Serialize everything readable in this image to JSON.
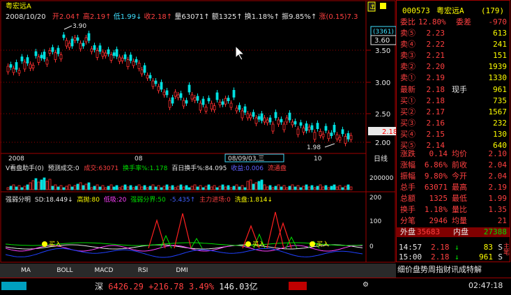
{
  "stock": {
    "code": "000573",
    "name": "粤宏远A",
    "count": "(179)"
  },
  "header": {
    "name": "粤宏远A",
    "date": "2008/10/20",
    "open_label": "开",
    "open": "2.04",
    "high_label": "高",
    "high": "2.19",
    "low_label": "低",
    "low": "1.99",
    "close_label": "收",
    "close": "2.18",
    "volume_label": "量",
    "volume": "63071",
    "amount_label": "额",
    "amount": "1325",
    "turnover_label": "换",
    "turnover": "1.18%",
    "amplitude_label": "振",
    "amplitude": "9.85%",
    "change_label": "涨",
    "change": "(0.15)7.3"
  },
  "price_axis": [
    "3.60",
    "3.50",
    "3.00",
    "2.50",
    "2.00"
  ],
  "price_box": {
    "top": "(3361)",
    "bottom": "3.60"
  },
  "price_annotations": {
    "high": "3.90",
    "low": "1.98",
    "current": "2.18"
  },
  "time_labels": [
    "2008",
    "08",
    "08/09/03,三",
    "10"
  ],
  "axis_tab": "日线",
  "volume_panel": {
    "title": "V看盘助手(0)",
    "forecast": "预测成交:0",
    "vol_label": "成交:",
    "vol": "63071",
    "turn_label": "换手率%:",
    "turn": "1.178",
    "hundred_label": "百日换手%:",
    "hundred": "84.095",
    "profit_label": "收益:",
    "profit": "0.006",
    "flow": "流通盘",
    "axis": "200000"
  },
  "indicator_panel": {
    "title": "强弱分明",
    "sd_label": "SD:",
    "sd": "18.449",
    "high_label": "高抛:",
    "high": "80",
    "low_label": "低吸:",
    "low": "20",
    "split_label": "强弱分界:",
    "split": "50",
    "neg": "-5.435",
    "main_label": "主力进场:",
    "main": "0",
    "wash_label": "洗盘:",
    "wash": "1.814",
    "axis": [
      "200",
      "100",
      "0"
    ],
    "buy_label": "买入"
  },
  "tabs": [
    "MA",
    "BOLL",
    "MACD",
    "RSI",
    "DMI"
  ],
  "quote": {
    "ratio_label": "委比",
    "ratio": "12.80%",
    "diff_label": "委差",
    "diff": "-970",
    "sells": [
      {
        "label": "卖⑤",
        "price": "2.23",
        "vol": "613"
      },
      {
        "label": "卖④",
        "price": "2.22",
        "vol": "241"
      },
      {
        "label": "卖③",
        "price": "2.21",
        "vol": "151"
      },
      {
        "label": "卖②",
        "price": "2.20",
        "vol": "1939"
      },
      {
        "label": "卖①",
        "price": "2.19",
        "vol": "1330"
      }
    ],
    "last_label": "最新",
    "last": "2.18",
    "cur_label": "现手",
    "cur": "961",
    "buys": [
      {
        "label": "买①",
        "price": "2.18",
        "vol": "735"
      },
      {
        "label": "买②",
        "price": "2.17",
        "vol": "1567"
      },
      {
        "label": "买③",
        "price": "2.16",
        "vol": "232"
      },
      {
        "label": "买④",
        "price": "2.15",
        "vol": "130"
      },
      {
        "label": "买⑤",
        "price": "2.14",
        "vol": "640"
      }
    ],
    "stats": [
      {
        "l1": "涨跌",
        "v1": "0.14",
        "l2": "均价",
        "v2": "2.10"
      },
      {
        "l1": "涨幅",
        "v1": "6.86%",
        "l2": "前收",
        "v2": "2.04"
      },
      {
        "l1": "振幅",
        "v1": "9.80%",
        "l2": "今开",
        "v2": "2.04"
      },
      {
        "l1": "总手",
        "v1": "63071",
        "l2": "最高",
        "v2": "2.19"
      },
      {
        "l1": "总额",
        "v1": "1325",
        "l2": "最低",
        "v2": "1.99"
      },
      {
        "l1": "换手",
        "v1": "1.18%",
        "l2": "量比",
        "v2": "1.35"
      },
      {
        "l1": "分笔",
        "v1": "2946",
        "l2": "均量",
        "v2": "21"
      }
    ],
    "outer_label": "外盘",
    "outer": "35683",
    "inner_label": "内盘",
    "inner": "27388",
    "ticks": [
      {
        "time": "14:57",
        "price": "2.18",
        "dir": "↓",
        "vol": "83",
        "flag": "S"
      },
      {
        "time": "15:00",
        "price": "2.18",
        "dir": "↓",
        "vol": "961",
        "flag": "S"
      }
    ],
    "tabs": "细价盘势周指财讯成特解",
    "side_tabs": "主笔"
  },
  "status": {
    "market": "深",
    "index": "6426.29",
    "change": "+216.78",
    "pct": "3.49%",
    "amount": "146.03亿",
    "time": "02:47:18"
  }
}
